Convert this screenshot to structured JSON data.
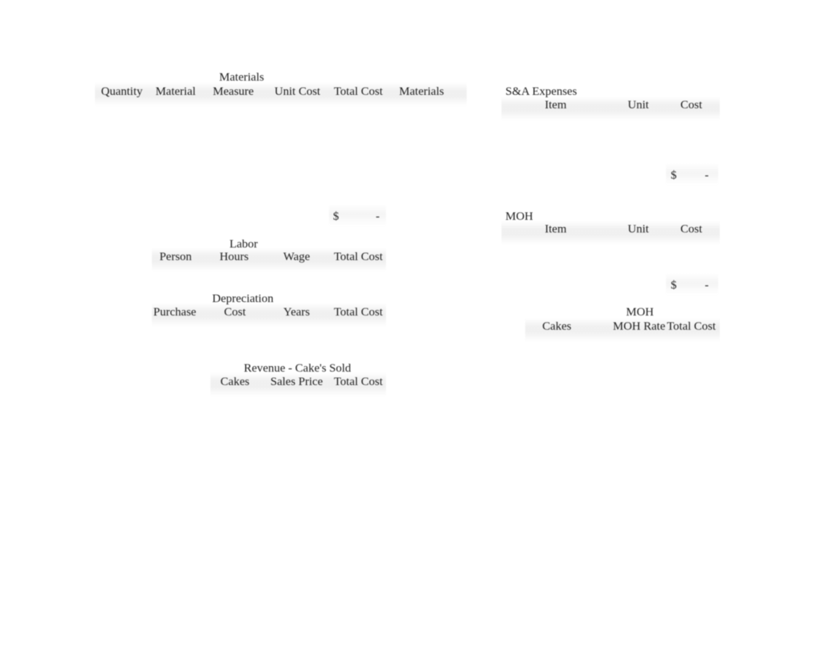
{
  "document": {
    "type": "spreadsheet",
    "background_color": "#ffffff",
    "text_color": "#1d1d1d",
    "band_color": "#f0f0f0"
  },
  "materials_table": {
    "title": "Materials",
    "columns": [
      "Quantity",
      "Material",
      "Measure",
      "Unit Cost",
      "Total Cost",
      "Materials"
    ],
    "rows": [],
    "total": {
      "currency": "$",
      "value": "-"
    }
  },
  "labor_table": {
    "title": "Labor",
    "columns": [
      "Person",
      "Hours",
      "Wage",
      "Total Cost"
    ],
    "rows": []
  },
  "depreciation_table": {
    "title": "Depreciation",
    "columns": [
      "Purchase",
      "Cost",
      "Years",
      "Total Cost"
    ],
    "rows": []
  },
  "revenue_table": {
    "title": "Revenue - Cake's Sold",
    "columns": [
      "Cakes",
      "Sales Price",
      "Total Cost"
    ],
    "rows": []
  },
  "sa_expenses_table": {
    "title": "S&A Expenses",
    "columns": [
      "Item",
      "Unit",
      "Cost"
    ],
    "rows": [],
    "total": {
      "currency": "$",
      "value": "-"
    }
  },
  "moh_table": {
    "title": "MOH",
    "columns": [
      "Item",
      "Unit",
      "Cost"
    ],
    "rows": [],
    "total": {
      "currency": "$",
      "value": "-"
    }
  },
  "moh_rate_table": {
    "title": "MOH",
    "columns": [
      "Cakes",
      "MOH Rate",
      "Total Cost"
    ],
    "rows": []
  }
}
